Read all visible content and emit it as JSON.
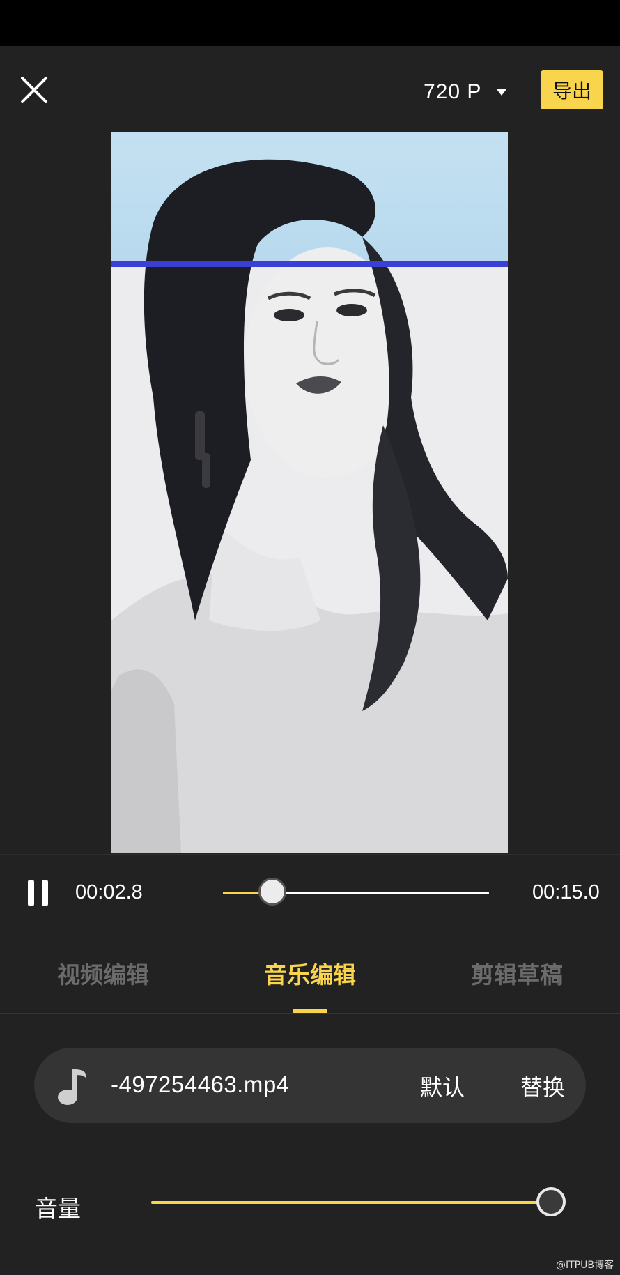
{
  "header": {
    "close_icon": "close-icon",
    "resolution": "720 P",
    "export_label": "导出",
    "export_color": "#f9d44d"
  },
  "preview": {
    "accent_line_color": "#3a3fd6",
    "sky_color": "#c4e1f1"
  },
  "playback": {
    "state_icon": "pause-icon",
    "current_time": "00:02.8",
    "total_time": "00:15.0",
    "progress_fraction": 0.187
  },
  "tabs": [
    {
      "label": "视频编辑",
      "active": false
    },
    {
      "label": "音乐编辑",
      "active": true
    },
    {
      "label": "剪辑草稿",
      "active": false
    }
  ],
  "music": {
    "icon": "music-note-icon",
    "file_name": "-497254463.mp4",
    "default_label": "默认",
    "replace_label": "替换"
  },
  "volume": {
    "label": "音量",
    "level_fraction": 1.0
  },
  "watermark": "@ITPUB博客",
  "colors": {
    "background": "#222222",
    "accent": "#f9d44d",
    "inactive_tab": "#6b6b6b"
  }
}
